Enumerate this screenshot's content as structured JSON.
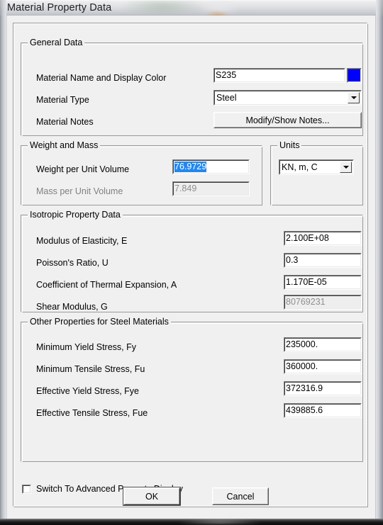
{
  "window": {
    "title": "Material Property Data"
  },
  "general": {
    "legend": "General Data",
    "name_label": "Material Name and Display Color",
    "name_value": "S235",
    "display_color": "#0000FF",
    "type_label": "Material Type",
    "type_value": "Steel",
    "notes_label": "Material Notes",
    "notes_button": "Modify/Show Notes..."
  },
  "weight_mass": {
    "legend": "Weight and Mass",
    "weight_label": "Weight per Unit Volume",
    "weight_value": "76.9729",
    "weight_selected": true,
    "mass_label": "Mass per Unit Volume",
    "mass_value": "7.849",
    "mass_readonly": true
  },
  "units": {
    "legend": "Units",
    "value": "KN, m, C"
  },
  "isotropic": {
    "legend": "Isotropic Property Data",
    "rows": [
      {
        "label": "Modulus of Elasticity,  E",
        "value": "2.100E+08",
        "readonly": false
      },
      {
        "label": "Poisson's Ratio,  U",
        "value": "0.3",
        "readonly": false
      },
      {
        "label": "Coefficient of Thermal Expansion,  A",
        "value": "1.170E-05",
        "readonly": false
      },
      {
        "label": "Shear Modulus,  G",
        "value": "80769231",
        "readonly": true
      }
    ]
  },
  "other_properties": {
    "legend": "Other Properties for Steel Materials",
    "rows": [
      {
        "label": "Minimum Yield Stress, Fy",
        "value": "235000."
      },
      {
        "label": "Minimum Tensile Stress, Fu",
        "value": "360000."
      },
      {
        "label": "Effective Yield Stress, Fye",
        "value": "372316.9"
      },
      {
        "label": "Effective Tensile Stress, Fue",
        "value": "439885.6"
      }
    ]
  },
  "footer": {
    "advanced_checkbox_label": "Switch To Advanced Property Display",
    "advanced_checked": false,
    "ok_label": "OK",
    "cancel_label": "Cancel"
  }
}
